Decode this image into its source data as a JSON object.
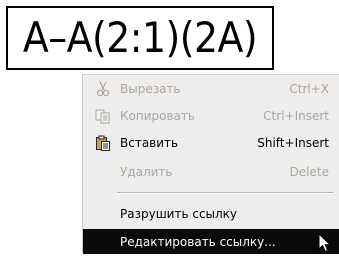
{
  "label": {
    "text": "A–A(2:1)(2A)"
  },
  "context_menu": {
    "items": [
      {
        "label": "Вырезать",
        "shortcut": "Ctrl+X",
        "icon": "scissors-icon",
        "enabled": false
      },
      {
        "label": "Копировать",
        "shortcut": "Ctrl+Insert",
        "icon": "copy-icon",
        "enabled": false
      },
      {
        "label": "Вставить",
        "shortcut": "Shift+Insert",
        "icon": "paste-icon",
        "enabled": true
      },
      {
        "label": "Удалить",
        "shortcut": "Delete",
        "enabled": false
      },
      {
        "label": "Разрушить ссылку",
        "enabled": true
      },
      {
        "label": "Редактировать ссылку...",
        "enabled": true,
        "selected": true
      }
    ]
  },
  "colors": {
    "menu_bg": "#efedeb",
    "highlight": "#0a0a0a",
    "disabled_text": "#a9a6a1"
  }
}
